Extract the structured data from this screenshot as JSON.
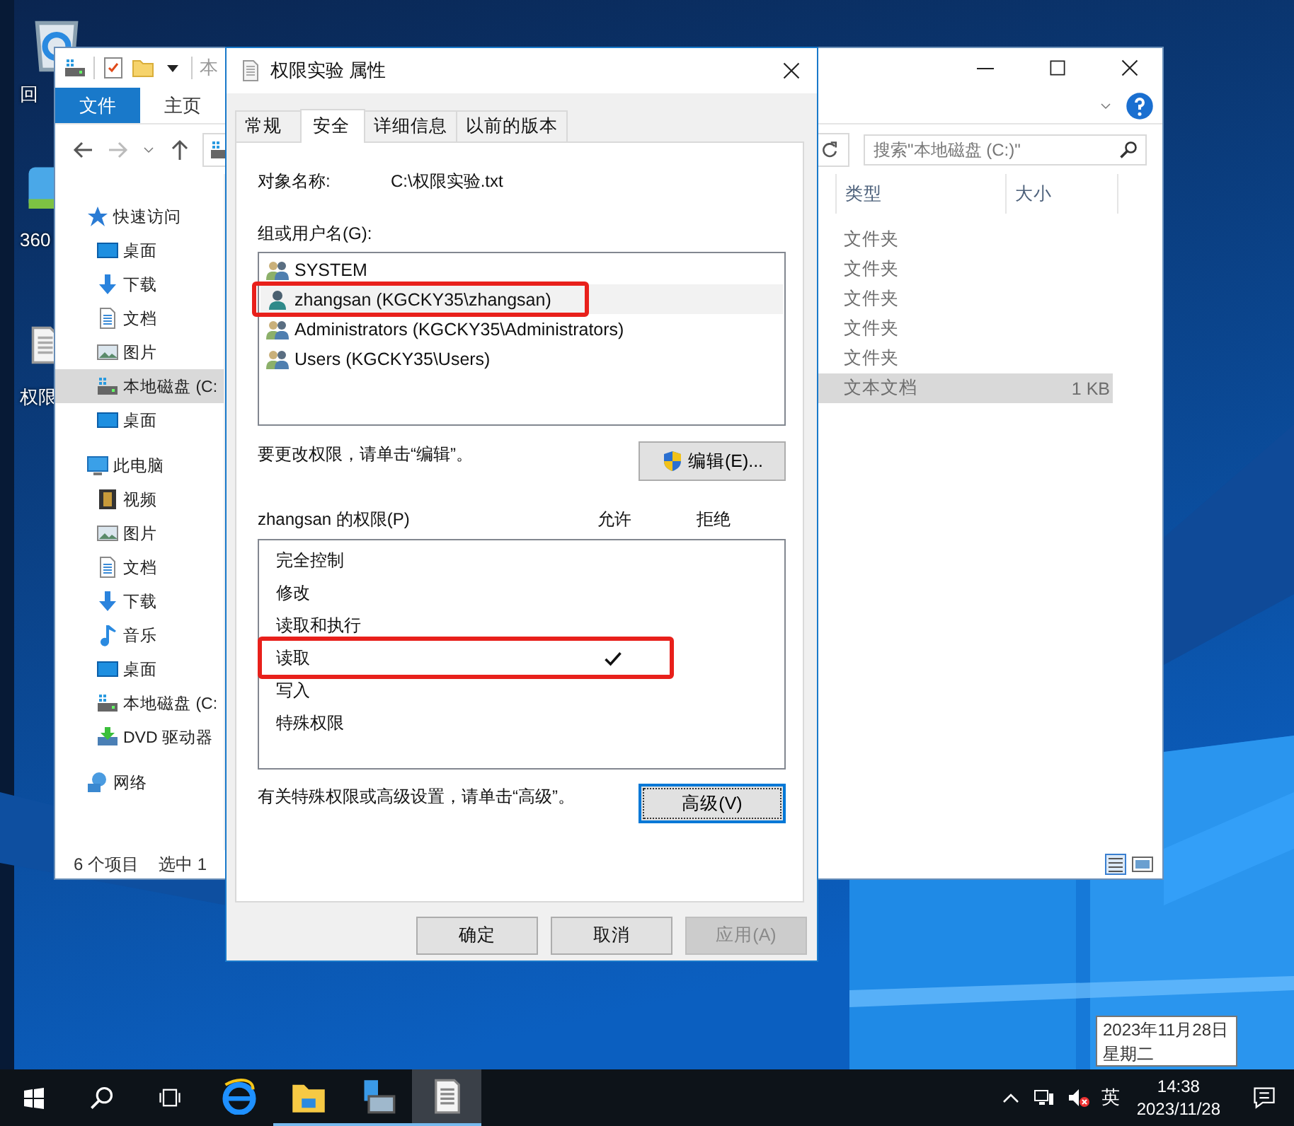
{
  "desktop": {
    "icons": [
      {
        "kind": "recycle",
        "label": "回"
      },
      {
        "kind": "zip",
        "label": "360"
      },
      {
        "kind": "text",
        "label": "权限"
      }
    ]
  },
  "explorer": {
    "title_fragment": "本",
    "ribbon_tabs": [
      {
        "label": "文件",
        "selected": true
      },
      {
        "label": "主页",
        "selected": false
      }
    ],
    "search": {
      "placeholder": "搜索\"本地磁盘 (C:)\""
    },
    "sidebar": [
      {
        "label": "快速访问",
        "kind": "star",
        "selected": false,
        "children": [
          {
            "label": "桌面",
            "kind": "desktop",
            "selected": false
          },
          {
            "label": "下载",
            "kind": "download",
            "selected": false
          },
          {
            "label": "文档",
            "kind": "document",
            "selected": false
          },
          {
            "label": "图片",
            "kind": "picture",
            "selected": false
          },
          {
            "label": "本地磁盘 (C:",
            "kind": "drive",
            "selected": true
          },
          {
            "label": "桌面",
            "kind": "desktop",
            "selected": false
          }
        ]
      },
      {
        "label": "此电脑",
        "kind": "pc",
        "selected": false,
        "children": [
          {
            "label": "视频",
            "kind": "video",
            "selected": false
          },
          {
            "label": "图片",
            "kind": "picture",
            "selected": false
          },
          {
            "label": "文档",
            "kind": "document",
            "selected": false
          },
          {
            "label": "下载",
            "kind": "download",
            "selected": false
          },
          {
            "label": "音乐",
            "kind": "music",
            "selected": false
          },
          {
            "label": "桌面",
            "kind": "desktop",
            "selected": false
          },
          {
            "label": "本地磁盘 (C:",
            "kind": "drive",
            "selected": false
          },
          {
            "label": "DVD 驱动器",
            "kind": "dvd",
            "selected": false
          }
        ]
      },
      {
        "label": "网络",
        "kind": "network",
        "selected": false
      }
    ],
    "columns": [
      "类型",
      "大小"
    ],
    "rows": [
      {
        "type": "文件夹",
        "selected": false
      },
      {
        "type": "文件夹",
        "selected": false
      },
      {
        "type": "文件夹",
        "selected": false
      },
      {
        "type": "文件夹",
        "selected": false
      },
      {
        "type": "文件夹",
        "selected": false
      },
      {
        "type": "文本文档",
        "size": "1 KB",
        "selected": true
      }
    ],
    "status": {
      "count": "6 个项目",
      "selection": "选中 1"
    }
  },
  "dialog": {
    "title": "权限实验 属性",
    "tabs": [
      {
        "label": "常规",
        "selected": false
      },
      {
        "label": "安全",
        "selected": true
      },
      {
        "label": "详细信息",
        "selected": false
      },
      {
        "label": "以前的版本",
        "selected": false
      }
    ],
    "object_label": "对象名称:",
    "object_value": "C:\\权限实验.txt",
    "users_label": "组或用户名(G):",
    "users": [
      {
        "name": "SYSTEM",
        "kind": "group",
        "selected": false,
        "highlighted": false
      },
      {
        "name": "zhangsan (KGCKY35\\zhangsan)",
        "kind": "user",
        "selected": true,
        "highlighted": true
      },
      {
        "name": "Administrators (KGCKY35\\Administrators)",
        "kind": "group",
        "selected": false,
        "highlighted": false
      },
      {
        "name": "Users (KGCKY35\\Users)",
        "kind": "group",
        "selected": false,
        "highlighted": false
      }
    ],
    "edit_hint": "要更改权限，请单击“编辑”。",
    "edit_button": "编辑(E)...",
    "permissions_label": "zhangsan 的权限(P)",
    "allow_label": "允许",
    "deny_label": "拒绝",
    "permissions": [
      {
        "name": "完全控制",
        "allow": false,
        "deny": false,
        "highlighted": false
      },
      {
        "name": "修改",
        "allow": false,
        "deny": false,
        "highlighted": false
      },
      {
        "name": "读取和执行",
        "allow": false,
        "deny": false,
        "highlighted": false
      },
      {
        "name": "读取",
        "allow": true,
        "deny": false,
        "highlighted": true
      },
      {
        "name": "写入",
        "allow": false,
        "deny": false,
        "highlighted": false
      },
      {
        "name": "特殊权限",
        "allow": false,
        "deny": false,
        "highlighted": false
      }
    ],
    "advanced_hint": "有关特殊权限或高级设置，请单击“高级”。",
    "advanced_button": "高级(V)",
    "buttons": [
      {
        "label": "确定",
        "disabled": false
      },
      {
        "label": "取消",
        "disabled": false
      },
      {
        "label": "应用(A)",
        "disabled": true
      }
    ]
  },
  "taskbar": {
    "apps": [
      {
        "kind": "ie",
        "running": false,
        "selected": false
      },
      {
        "kind": "explorer",
        "running": true,
        "selected": false
      },
      {
        "kind": "server",
        "running": true,
        "selected": false
      },
      {
        "kind": "notepad",
        "running": true,
        "selected": true
      }
    ],
    "ime": "英",
    "time": "14:38",
    "date": "2023/11/28"
  },
  "tooltip": {
    "lines": [
      "2023年11月28日",
      "星期二"
    ]
  }
}
